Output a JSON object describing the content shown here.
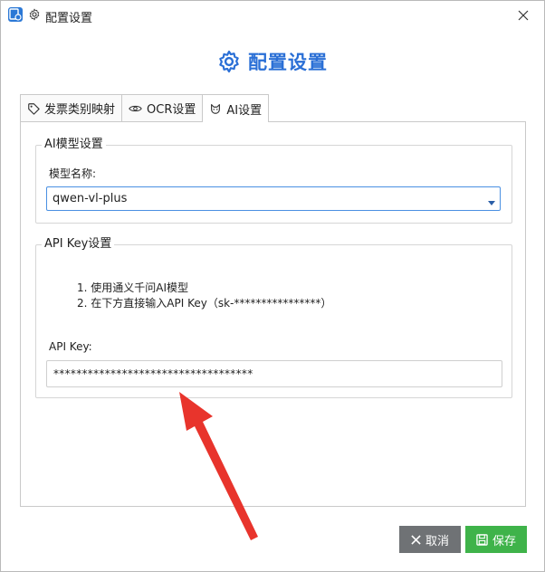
{
  "window": {
    "title": "配置设置"
  },
  "header": {
    "title": "配置设置"
  },
  "tabs": [
    {
      "label": "发票类别映射",
      "icon": "tag-icon"
    },
    {
      "label": "OCR设置",
      "icon": "eye-icon"
    },
    {
      "label": "AI设置",
      "icon": "ai-icon",
      "active": true
    }
  ],
  "ai_model_group": {
    "legend": "AI模型设置",
    "model_name_label": "模型名称:",
    "model_name_value": "qwen-vl-plus"
  },
  "api_key_group": {
    "legend": "API Key设置",
    "instructions": [
      "1. 使用通义千问AI模型",
      "2. 在下方直接输入API Key（sk-****************）"
    ],
    "api_key_label": "API Key:",
    "api_key_value": "***********************************"
  },
  "buttons": {
    "cancel": "取消",
    "save": "保存"
  },
  "colors": {
    "accent": "#2a6fd6",
    "save": "#3fb34a",
    "cancel": "#6f7275",
    "annotation_arrow": "#e8342c"
  }
}
